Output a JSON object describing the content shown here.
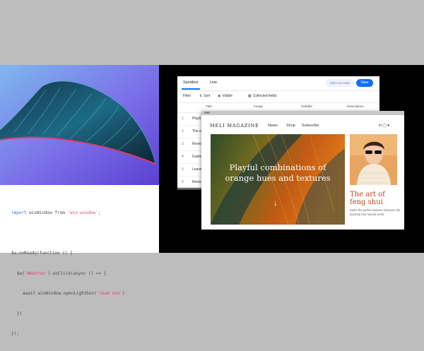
{
  "code": {
    "lines": [
      {
        "kw": "import",
        "plain": " wixWindow from ",
        "str": "'wix-window';"
      },
      {
        "plain": "$w.onReady(function () {"
      },
      {
        "plain": "$w(",
        "str": "'#button'",
        "rest": ").onClick(async () => {"
      },
      {
        "plain": "await wixWindow.openLightbox(",
        "str": "'lead now'",
        "rest": ")"
      },
      {
        "plain": "})"
      },
      {
        "plain": "});"
      }
    ]
  },
  "cms": {
    "tabs": [
      "Sandbox",
      "Live"
    ],
    "edit_label": "Edit Live Data",
    "save_label": "Save",
    "toolbar": {
      "filter": "Filter",
      "sort": "Sort",
      "visible": "Visible",
      "fields": "Collected fields"
    },
    "columns": [
      "Title",
      "Image",
      "Subtitle",
      "Description"
    ],
    "rows": [
      {
        "num": "1",
        "title": "Playful"
      },
      {
        "num": "2",
        "title": "The art"
      },
      {
        "num": "3",
        "title": "Reviving"
      },
      {
        "num": "4",
        "title": "Fashion"
      },
      {
        "num": "5",
        "title": "Leave"
      },
      {
        "num": "6",
        "title": "Reviving"
      }
    ]
  },
  "site": {
    "logo": "MELI MAGAZINE",
    "nav": [
      "News",
      "Shop",
      "Subscribe"
    ],
    "social": "in ◯ ♥",
    "hero_title": "Playful combinations of orange hues and textures",
    "hero_arrow": "↓",
    "side_title": "The art of feng shui",
    "side_subtitle": "Strike the perfect balance between the physical and natural world"
  },
  "colors": {
    "accent": "#116dff",
    "side_title": "#b8451f"
  },
  "icons": [
    "window-dots-icon",
    "sort-icon",
    "eye-icon",
    "fields-icon",
    "down-arrow-icon"
  ]
}
